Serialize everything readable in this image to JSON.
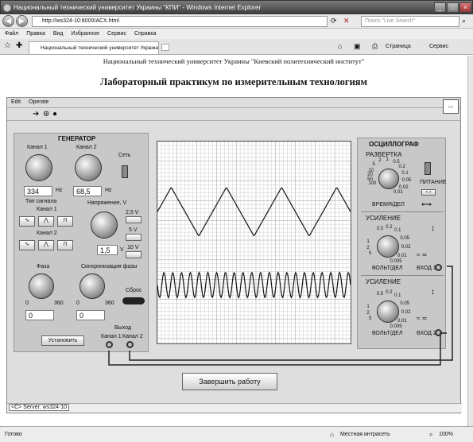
{
  "browser": {
    "title": "Национальный технический университет Украины \"КПИ\" - Windows Internet Explorer",
    "url": "http://ws324-10:8000/ACX.html",
    "search_placeholder": "Поиск \"Live Search\"",
    "menu": [
      "Файл",
      "Правка",
      "Вид",
      "Избранное",
      "Сервис",
      "Справка"
    ],
    "tab": "Национальный технический университет Украины ...",
    "tools": {
      "page": "Страница",
      "service": "Сервис"
    },
    "status": {
      "left": "Готово",
      "zone": "Местная интрасеть",
      "zoom": "100%"
    }
  },
  "page": {
    "header": "Национальный технический университет Украины \"Киевский политехнический институт\"",
    "title": "Лабораторный практикум по измерительным технологиям"
  },
  "vi": {
    "menu": [
      "Edit",
      "Operate"
    ],
    "generator": {
      "title": "ГЕНЕРАТОР",
      "ch1": "Канал 1",
      "ch2": "Канал 2",
      "network": "Сеть",
      "freq1": "334",
      "freq2": "68,5",
      "hz": "Hz",
      "signal_type": "Тип сигнала",
      "signal_ch1": "Канал 1",
      "signal_ch2": "Канал 2",
      "voltage": "Напряжение, V",
      "volt_value": "1,5",
      "volt_unit": "V",
      "volt_btns": [
        "2,5 V",
        "5 V",
        "10 V"
      ],
      "phase": "Фаза",
      "phase_sync": "Синхронизация фазы",
      "reset": "Сброс",
      "phase1": "0",
      "phase2": "0",
      "knob_min": "0",
      "knob_max": "360",
      "set": "Установить",
      "output": "Выход",
      "out1": "Канал 1",
      "out2": "Канал 2"
    },
    "osc": {
      "title": "ОСЦИЛЛОГРАФ",
      "sweep": "РАЗВЕРТКА",
      "sweep_ticks": [
        "5",
        "2",
        "1",
        "0.5",
        "0.2",
        "0.1",
        "0.05",
        "0.02",
        "0.01",
        "100",
        "50",
        "20",
        "10"
      ],
      "time_div": "ВРЕМЯ/ДЕЛ",
      "power": "ПИТАНИЕ",
      "gain": "УСИЛЕНИЕ",
      "gain_ticks": [
        "0.5",
        "0.2",
        "0.1",
        "0.05",
        "0.02",
        "0.01",
        "0.005",
        "1",
        "2",
        "5"
      ],
      "volt_div": "ВОЛЬТ/ДЕЛ",
      "in1": "ВХОД 1",
      "in2": "ВХОД 2"
    },
    "finish": "Завершить работу",
    "server": "<C> Server: ws324-10"
  },
  "chart_data": {
    "type": "line",
    "series": [
      {
        "name": "Канал 1",
        "shape": "triangle",
        "periods": 3.5
      },
      {
        "name": "Канал 2",
        "shape": "sine",
        "periods": 22
      }
    ]
  },
  "colors": {
    "titlebar": "#3f3f3f",
    "panel": "#c8c8c8",
    "grid": "#bdbdbd"
  }
}
